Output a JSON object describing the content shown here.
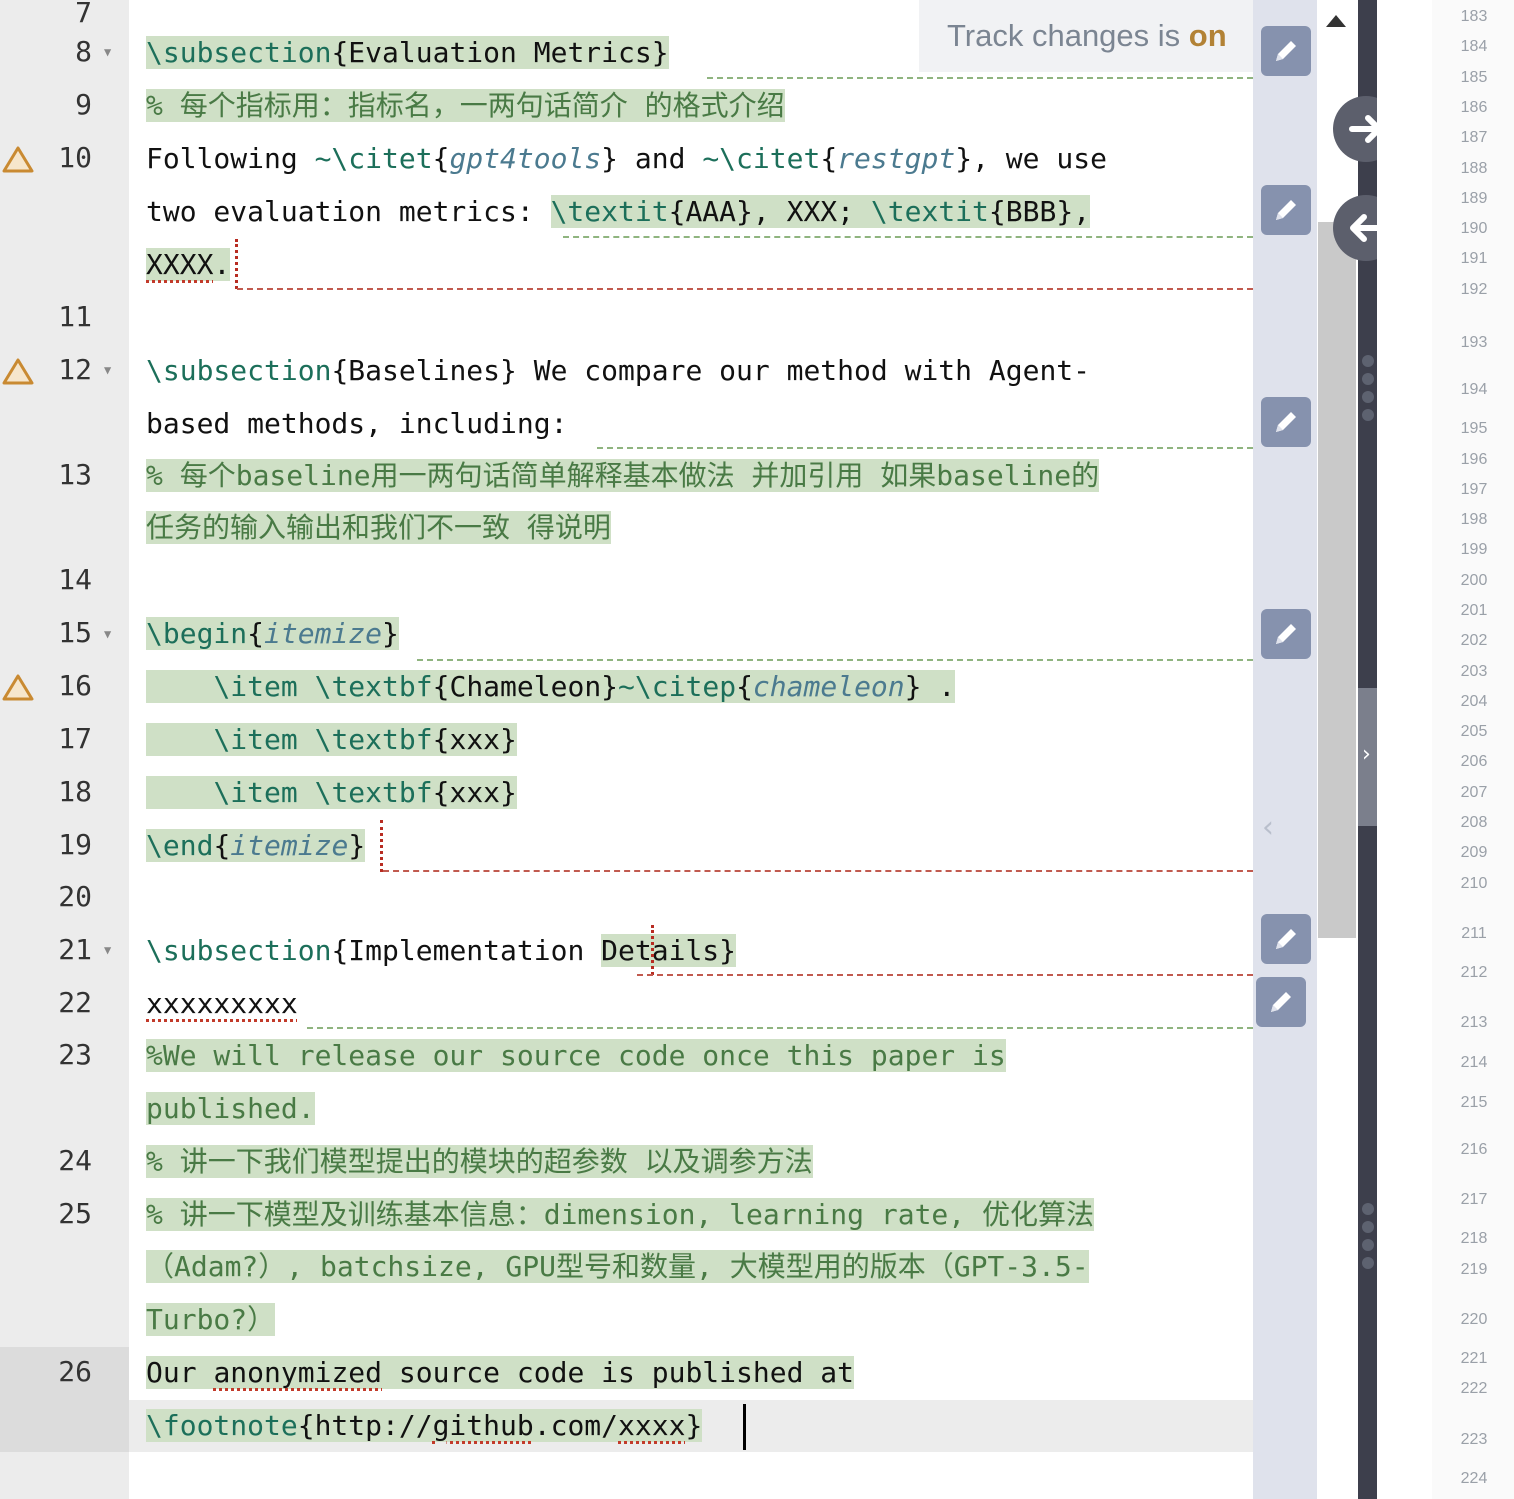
{
  "gutter": {
    "line_numbers": [
      "7",
      "8",
      "9",
      "10",
      "11",
      "12",
      "13",
      "14",
      "15",
      "16",
      "17",
      "18",
      "19",
      "20",
      "21",
      "22",
      "23",
      "24",
      "25",
      "26"
    ]
  },
  "track_changes": {
    "prefix": "Track changes is ",
    "state": "on"
  },
  "code": {
    "l8": {
      "cmd": "\\subsection",
      "arg": "{Evaluation Metrics}"
    },
    "l9": {
      "text": "% 每个指标用：指标名，一两句话简介 的格式介绍"
    },
    "l10a": {
      "t1": "Following ",
      "c1": "~\\citet",
      "b1": "{",
      "a1": "gpt4tools",
      "e1": "}",
      "t2": " and ",
      "c2": "~\\citet",
      "b2": "{",
      "a2": "restgpt",
      "e2": "}",
      "t3": ", we use"
    },
    "l10b": {
      "t1": "two evaluation metrics: ",
      "c1": "\\textit",
      "t2": "{AAA}, XXX; ",
      "c2": "\\textit",
      "t3": "{BBB},"
    },
    "l10c": {
      "t1": "XXXX",
      "t2": "."
    },
    "l12a": {
      "cmd": "\\subsection",
      "t1": "{Baselines} We compare our method with Agent-"
    },
    "l12b": {
      "t1": "based methods, including:"
    },
    "l13a": {
      "text": "% 每个baseline用一两句话简单解释基本做法 并加引用 如果baseline的"
    },
    "l13b": {
      "text": "任务的输入输出和我们不一致 得说明"
    },
    "l15": {
      "cmd": "\\begin",
      "b": "{",
      "arg": "itemize",
      "e": "}"
    },
    "l16": {
      "ind": "    ",
      "c1": "\\item ",
      "c2": "\\textbf",
      "t1": "{Chameleon}",
      "c3": "~\\citep",
      "b": "{",
      "arg": "chameleon",
      "e": "}",
      "t2": " ."
    },
    "l17": {
      "ind": "    ",
      "c1": "\\item ",
      "c2": "\\textbf",
      "t1": "{xxx}"
    },
    "l18": {
      "ind": "    ",
      "c1": "\\item ",
      "c2": "\\textbf",
      "t1": "{xxx}"
    },
    "l19": {
      "cmd": "\\end",
      "b": "{",
      "arg": "itemize",
      "e": "}"
    },
    "l21": {
      "cmd": "\\subsection",
      "t1": "{Implementation ",
      "t2": "Details}"
    },
    "l22": {
      "text": "xxxxxxxxx"
    },
    "l23a": {
      "text": "%We will release our source code once this paper is"
    },
    "l23b": {
      "text": "published."
    },
    "l24": {
      "text": "% 讲一下我们模型提出的模块的超参数 以及调参方法"
    },
    "l25a": {
      "text": "% 讲一下模型及训练基本信息：dimension, learning rate, 优化算法"
    },
    "l25b": {
      "text": "（Adam?）, batchsize, GPU型号和数量, 大模型用的版本（GPT-3.5-"
    },
    "l25c": {
      "text": "Turbo?）"
    },
    "l26a": {
      "t1": "Our ",
      "w1": "anonymized",
      "t2": " source code is published at"
    },
    "l26b": {
      "cmd": "\\footnote",
      "t1": "{http://",
      "w1": "github",
      "t2": ".com/",
      "w2": "xxxx",
      "t3": "}"
    }
  },
  "review_rail": {
    "icon": "pencil-icon"
  },
  "pdf_line_numbers": [
    "183",
    "184",
    "185",
    "186",
    "187",
    "188",
    "189",
    "190",
    "191",
    "192",
    "193",
    "194",
    "195",
    "196",
    "197",
    "198",
    "199",
    "200",
    "201",
    "202",
    "203",
    "204",
    "205",
    "206",
    "207",
    "208",
    "209",
    "210",
    "211",
    "212",
    "213",
    "214",
    "215",
    "216",
    "217",
    "218",
    "219",
    "220",
    "221",
    "222",
    "223",
    "224"
  ],
  "colors": {
    "added_bg": "#cfe0c6",
    "command": "#1c6f5a",
    "comment": "#497a45",
    "warning": "#c98a32",
    "pencil_btn": "#8692ae"
  }
}
